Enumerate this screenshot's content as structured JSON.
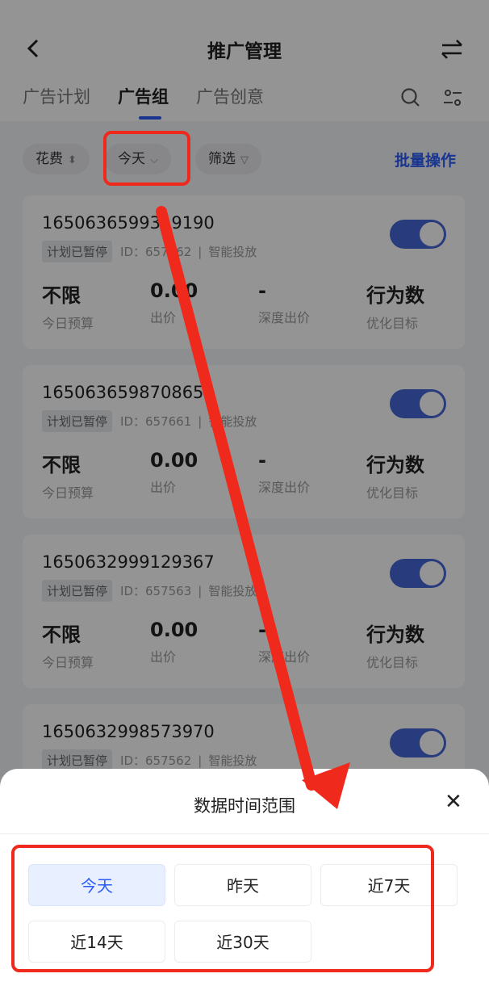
{
  "header": {
    "title": "推广管理",
    "tabs": [
      "广告计划",
      "广告组",
      "广告创意"
    ]
  },
  "filters": {
    "sort": "花费",
    "date": "今天",
    "filter": "筛选",
    "batch": "批量操作"
  },
  "cards": [
    {
      "id": "1650636599319190",
      "status": "计划已暂停",
      "adid": "ID：657662",
      "mode": "智能投放",
      "budget": "不限",
      "budget_label": "今日预算",
      "bid": "0.00",
      "bid_label": "出价",
      "deep": "-",
      "deep_label": "深度出价",
      "goal": "行为数",
      "goal_label": "优化目标"
    },
    {
      "id": "1650636598708656",
      "status": "计划已暂停",
      "adid": "ID：657661",
      "mode": "智能投放",
      "budget": "不限",
      "budget_label": "今日预算",
      "bid": "0.00",
      "bid_label": "出价",
      "deep": "-",
      "deep_label": "深度出价",
      "goal": "行为数",
      "goal_label": "优化目标"
    },
    {
      "id": "1650632999129367",
      "status": "计划已暂停",
      "adid": "ID：657563",
      "mode": "智能投放",
      "budget": "不限",
      "budget_label": "今日预算",
      "bid": "0.00",
      "bid_label": "出价",
      "deep": "-",
      "deep_label": "深度出价",
      "goal": "行为数",
      "goal_label": "优化目标"
    },
    {
      "id": "1650632998573970",
      "status": "计划已暂停",
      "adid": "ID：657562",
      "mode": "智能投放"
    }
  ],
  "sheet": {
    "title": "数据时间范围",
    "options": [
      "今天",
      "昨天",
      "近7天",
      "近14天",
      "近30天"
    ],
    "selected": "今天"
  },
  "colors": {
    "accent": "#2b5cf6",
    "annotation": "#ef2a1c"
  }
}
